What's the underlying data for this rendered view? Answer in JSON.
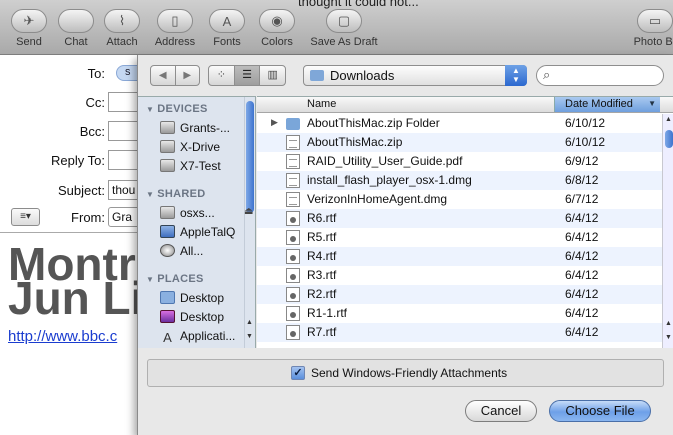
{
  "mail": {
    "window_title": "thought it could not...",
    "toolbar": [
      {
        "label": "Send",
        "icon": "send-icon",
        "glyph": "✈"
      },
      {
        "label": "Chat",
        "icon": "chat-icon",
        "glyph": ""
      },
      {
        "label": "Attach",
        "icon": "paperclip-icon",
        "glyph": "⌇"
      },
      {
        "label": "Address",
        "icon": "address-book-icon",
        "glyph": "▯"
      },
      {
        "label": "Fonts",
        "icon": "fonts-icon",
        "glyph": "A"
      },
      {
        "label": "Colors",
        "icon": "color-wheel-icon",
        "glyph": "◉"
      },
      {
        "label": "Save As Draft",
        "icon": "draft-icon",
        "glyph": "▢"
      },
      {
        "label": "Photo Br",
        "icon": "photo-browser-icon",
        "glyph": "▭"
      }
    ],
    "headers": {
      "to_label": "To:",
      "to_token": "s",
      "cc_label": "Cc:",
      "bcc_label": "Bcc:",
      "reply_to_label": "Reply To:",
      "subject_label": "Subject:",
      "subject_value": "thou",
      "from_label": "From:",
      "from_value": "Gra"
    },
    "format_button": "≡▾",
    "body": {
      "heading_line1": "Montre",
      "heading_line2": "Jun Li",
      "link": "http://www.bbc.c"
    }
  },
  "sheet": {
    "location": "Downloads",
    "search": {
      "value": "",
      "placeholder": ""
    },
    "nav": {
      "back": "◀",
      "forward": "▶"
    },
    "views": [
      "⁘",
      "☰",
      "▥"
    ],
    "sidebar": {
      "sections": [
        {
          "title": "DEVICES",
          "items": [
            {
              "label": "Grants-...",
              "icon": "hard-disk-icon"
            },
            {
              "label": "X-Drive",
              "icon": "drive-icon"
            },
            {
              "label": "X7-Test",
              "icon": "drive-icon"
            }
          ]
        },
        {
          "title": "SHARED",
          "items": [
            {
              "label": "osxs...",
              "icon": "network-share-icon",
              "eject": true
            },
            {
              "label": "AppleTalQ",
              "icon": "network-computer-icon"
            },
            {
              "label": "All...",
              "icon": "network-globe-icon"
            }
          ]
        },
        {
          "title": "PLACES",
          "items": [
            {
              "label": "Desktop",
              "icon": "desktop-folder-icon"
            },
            {
              "label": "Desktop",
              "icon": "desktop-image-icon"
            },
            {
              "label": "Applicati...",
              "icon": "applications-icon"
            }
          ]
        }
      ]
    },
    "columns": {
      "name": "Name",
      "date": "Date Modified"
    },
    "files": [
      {
        "name": "AboutThisMac.zip Folder",
        "date": "6/10/12",
        "kind": "folder"
      },
      {
        "name": "AboutThisMac.zip",
        "date": "6/10/12",
        "kind": "doc"
      },
      {
        "name": "RAID_Utility_User_Guide.pdf",
        "date": "6/9/12",
        "kind": "doc"
      },
      {
        "name": "install_flash_player_osx-1.dmg",
        "date": "6/8/12",
        "kind": "doc"
      },
      {
        "name": "VerizonInHomeAgent.dmg",
        "date": "6/7/12",
        "kind": "doc"
      },
      {
        "name": "R6.rtf",
        "date": "6/4/12",
        "kind": "rtf"
      },
      {
        "name": "R5.rtf",
        "date": "6/4/12",
        "kind": "rtf"
      },
      {
        "name": "R4.rtf",
        "date": "6/4/12",
        "kind": "rtf"
      },
      {
        "name": "R3.rtf",
        "date": "6/4/12",
        "kind": "rtf"
      },
      {
        "name": "R2.rtf",
        "date": "6/4/12",
        "kind": "rtf"
      },
      {
        "name": "R1-1.rtf",
        "date": "6/4/12",
        "kind": "rtf"
      },
      {
        "name": "R7.rtf",
        "date": "6/4/12",
        "kind": "rtf"
      }
    ],
    "option_checkbox": {
      "label": "Send Windows-Friendly Attachments",
      "checked": true
    },
    "buttons": {
      "cancel": "Cancel",
      "choose": "Choose File"
    }
  }
}
